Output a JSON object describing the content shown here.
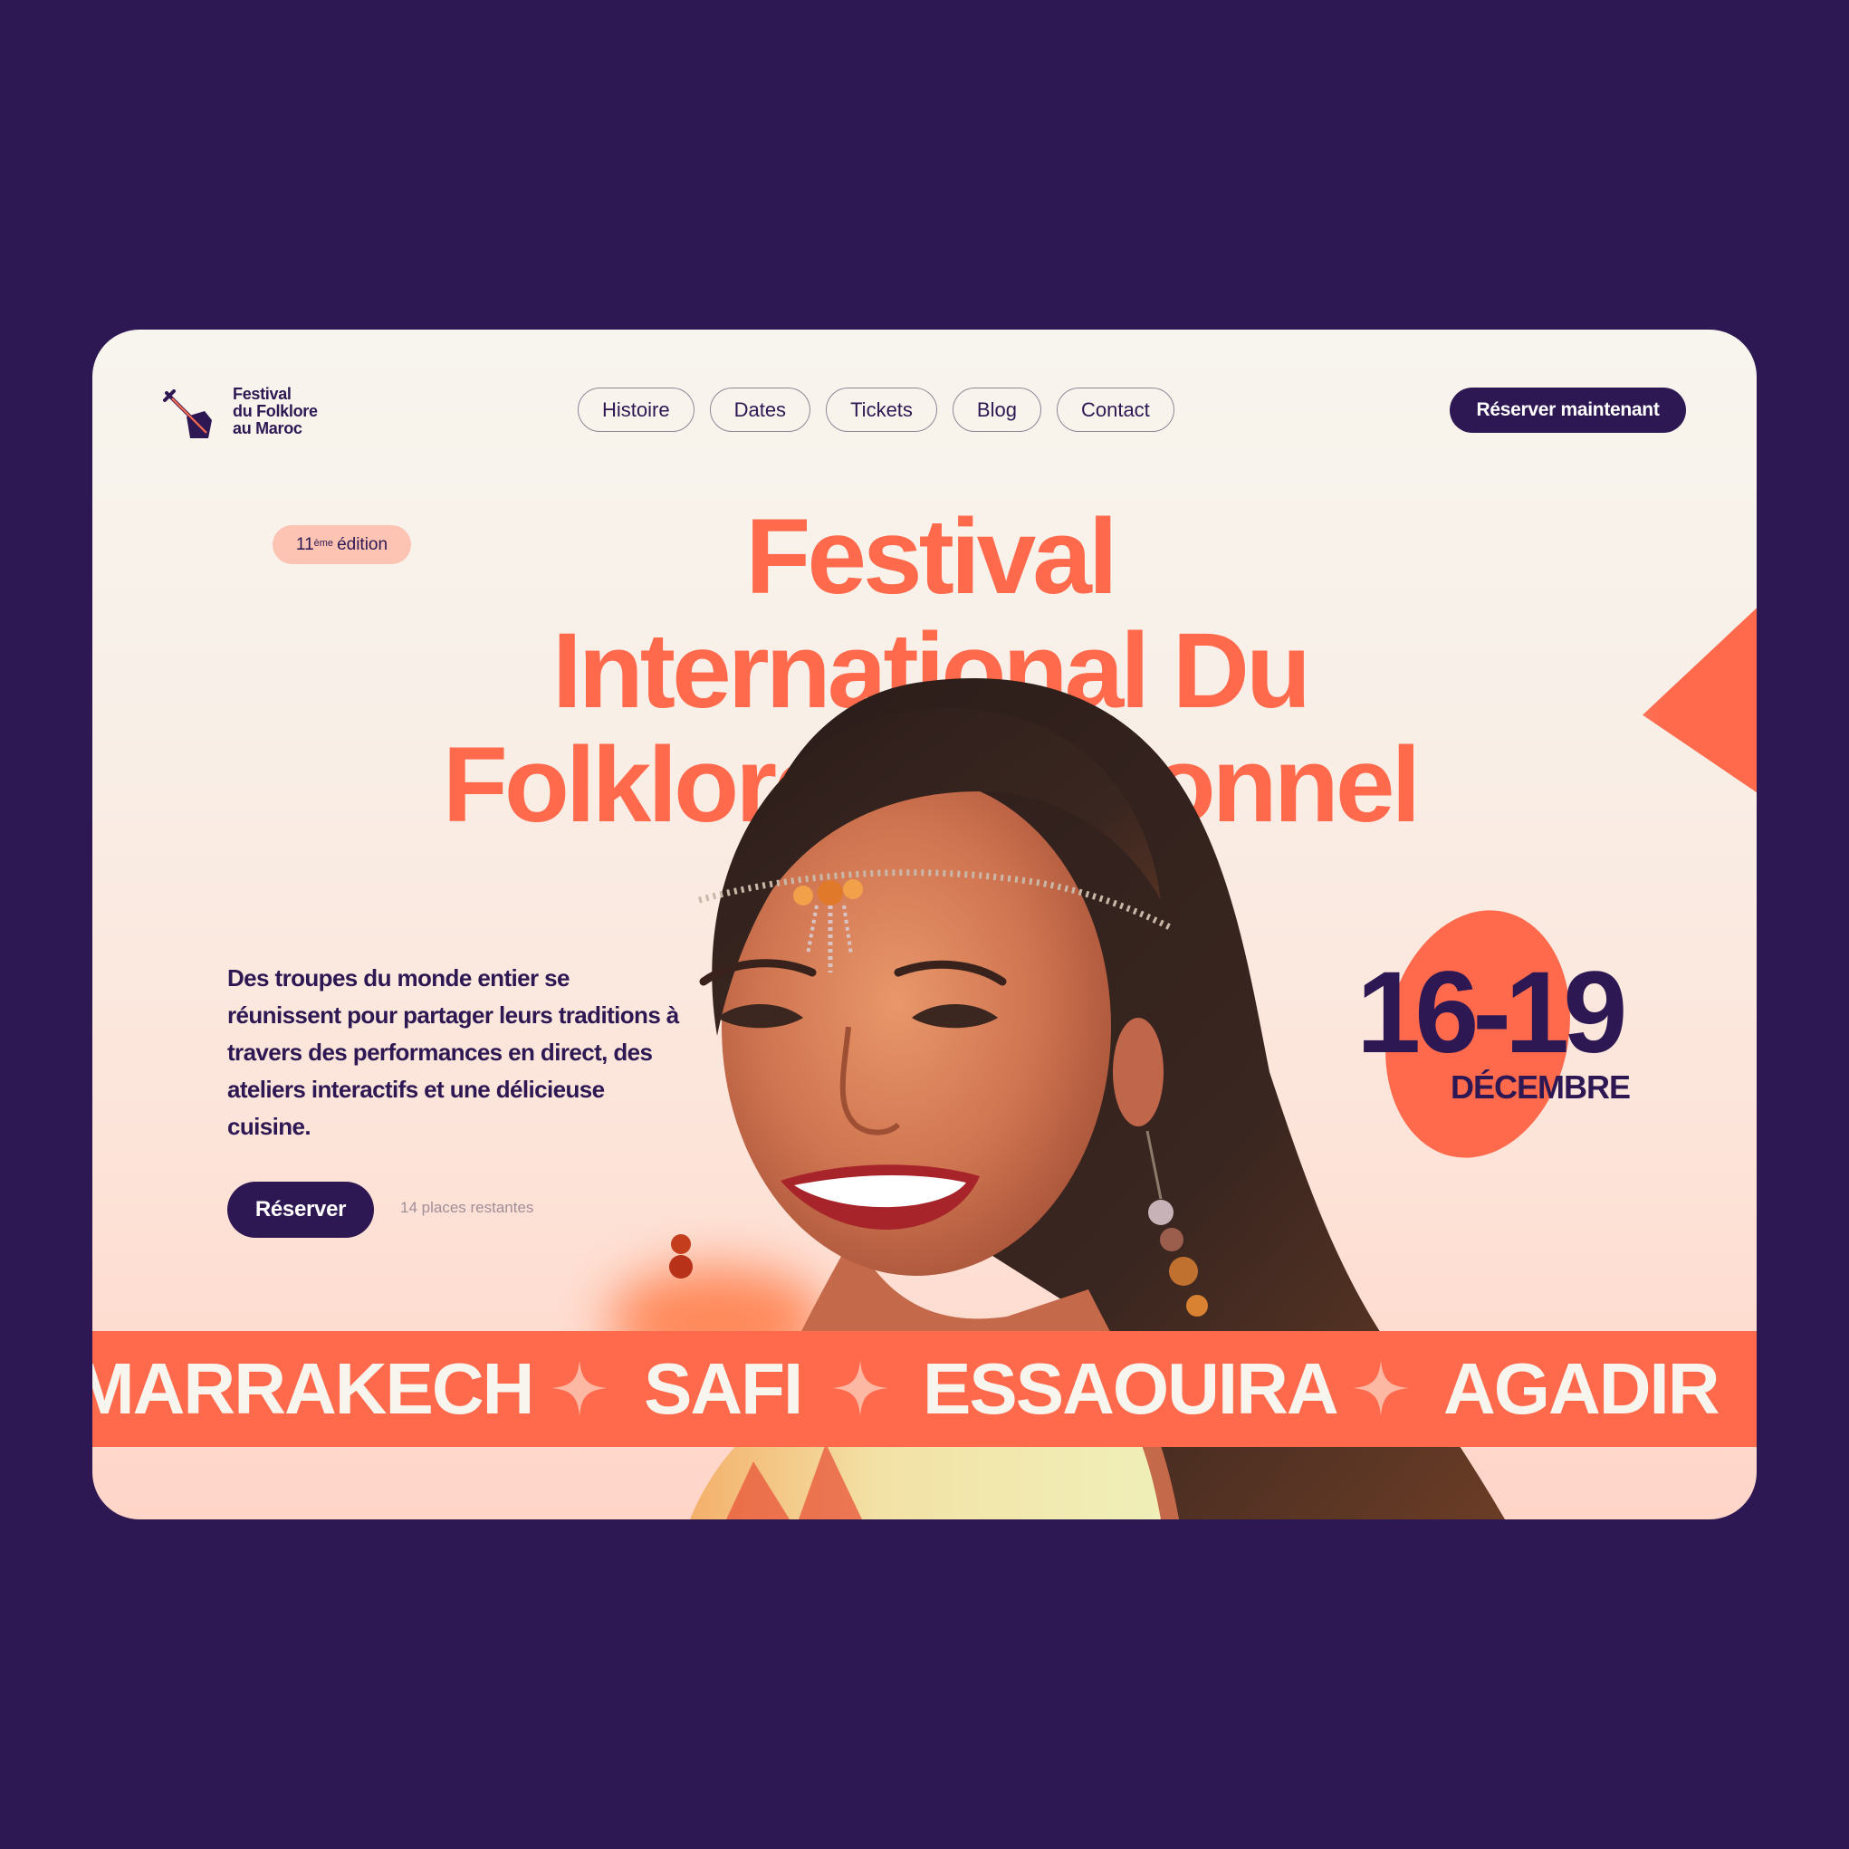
{
  "brand": {
    "line1": "Festival",
    "line2": "du Folklore",
    "line3": "au Maroc"
  },
  "nav": [
    "Histoire",
    "Dates",
    "Tickets",
    "Blog",
    "Contact"
  ],
  "header_cta": "Réserver maintenant",
  "edition": {
    "number": "11",
    "suffix": "ème",
    "label": "édition"
  },
  "hero": {
    "line1": "Festival",
    "line2": "International Du",
    "line3": "Folklore Traditionnel"
  },
  "description": "Des troupes du monde entier se réunissent pour partager leurs traditions à travers des performances en direct, des ateliers interactifs et une délicieuse cuisine.",
  "reserve_button": "Réserver",
  "places_left": "14 places restantes",
  "dates": {
    "range": "16-19",
    "month": "DÉCEMBRE"
  },
  "cities": [
    "MARRAKECH",
    "SAFI",
    "ESSAOUIRA",
    "AGADIR"
  ],
  "colors": {
    "background": "#2d1853",
    "accent": "#ff6a4d",
    "primary": "#2d1853",
    "cream": "#f8f5ee"
  }
}
